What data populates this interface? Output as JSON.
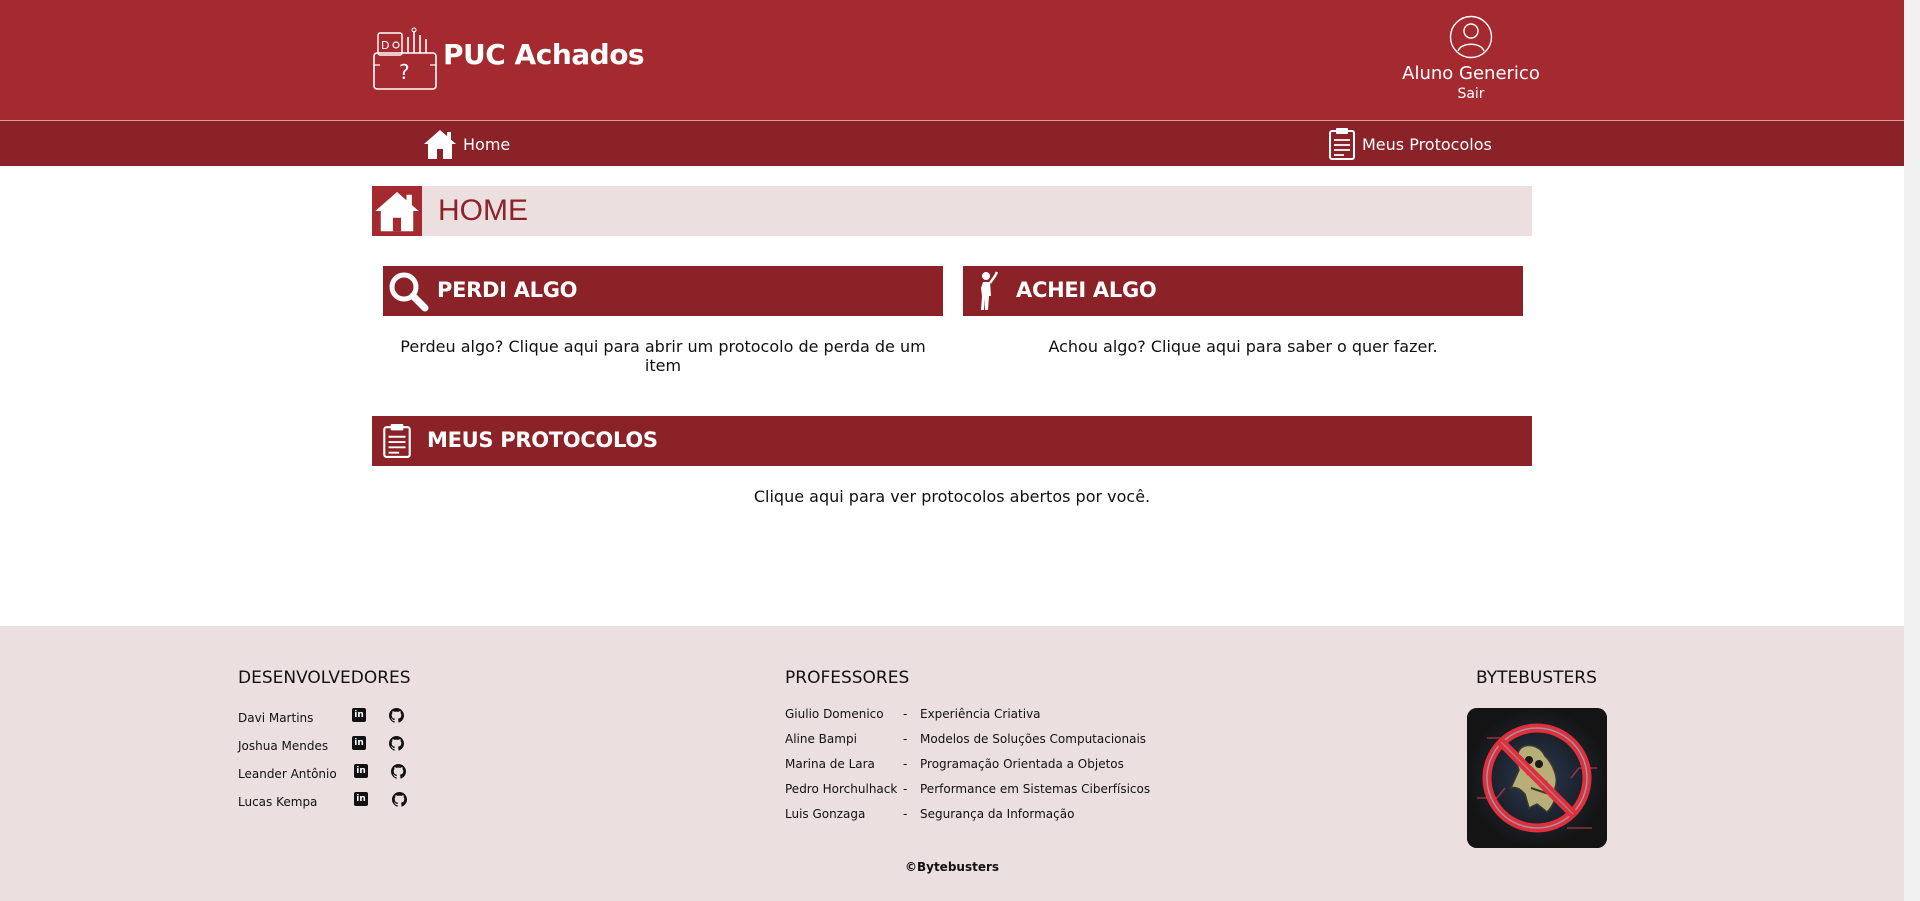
{
  "header": {
    "brand": "PUC Achados",
    "user_name": "Aluno Generico",
    "logout_label": "Sair"
  },
  "nav": {
    "home_label": "Home",
    "protocols_label": "Meus Protocolos"
  },
  "page": {
    "title": "HOME"
  },
  "cards": {
    "lost": {
      "title": "PERDI ALGO",
      "description": "Perdeu algo? Clique aqui para abrir um protocolo de perda de um item"
    },
    "found": {
      "title": "ACHEI ALGO",
      "description": "Achou algo? Clique aqui para saber o quer fazer."
    },
    "protocols": {
      "title": "MEUS PROTOCOLOS",
      "description": "Clique aqui para ver protocolos abertos por você."
    }
  },
  "footer": {
    "developers_title": "DESENVOLVEDORES",
    "developers": [
      {
        "name": "Davi Martins",
        "linkedin": "in"
      },
      {
        "name": "Joshua Mendes",
        "linkedin": "in"
      },
      {
        "name": "Leander Antônio",
        "linkedin": "in"
      },
      {
        "name": "Lucas Kempa",
        "linkedin": "in"
      }
    ],
    "professors_title": "PROFESSORES",
    "professors": [
      {
        "name": "Giulio Domenico",
        "sep": "-",
        "course": "Experiência Criativa"
      },
      {
        "name": "Aline Bampi",
        "sep": "-",
        "course": "Modelos de Soluções Computacionais"
      },
      {
        "name": "Marina de Lara",
        "sep": "-",
        "course": "Programação Orientada a Objetos"
      },
      {
        "name": "Pedro Horchulhack",
        "sep": "-",
        "course": "Performance em Sistemas Ciberfísicos"
      },
      {
        "name": "Luis Gonzaga",
        "sep": "-",
        "course": "Segurança da Informação"
      }
    ],
    "team_title": "BYTEBUSTERS",
    "copyright": "©Bytebusters"
  },
  "colors": {
    "primary": "#a52a30",
    "primary_dark": "#8b2227",
    "light_bg": "#ebdfe0"
  }
}
